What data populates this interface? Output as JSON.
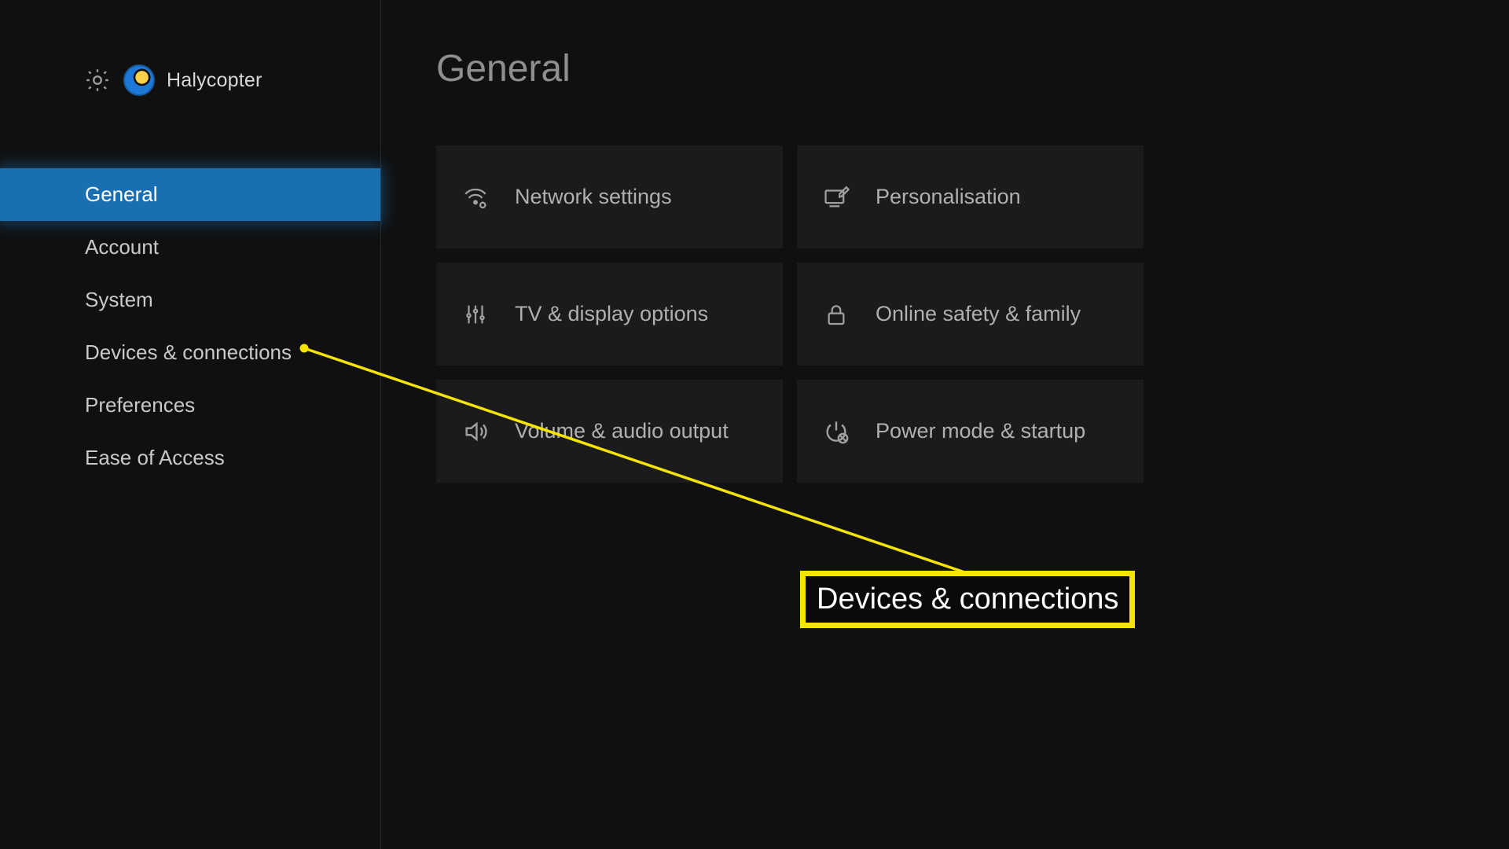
{
  "profile": {
    "username": "Halycopter"
  },
  "sidebar": {
    "items": [
      {
        "label": "General"
      },
      {
        "label": "Account"
      },
      {
        "label": "System"
      },
      {
        "label": "Devices & connections"
      },
      {
        "label": "Preferences"
      },
      {
        "label": "Ease of Access"
      }
    ],
    "active_index": 0
  },
  "page": {
    "title": "General"
  },
  "tiles": [
    {
      "label": "Network settings"
    },
    {
      "label": "Personalisation"
    },
    {
      "label": "TV & display options"
    },
    {
      "label": "Online safety & family"
    },
    {
      "label": "Volume & audio output"
    },
    {
      "label": "Power mode & startup"
    }
  ],
  "callout": {
    "text": "Devices & connections"
  }
}
